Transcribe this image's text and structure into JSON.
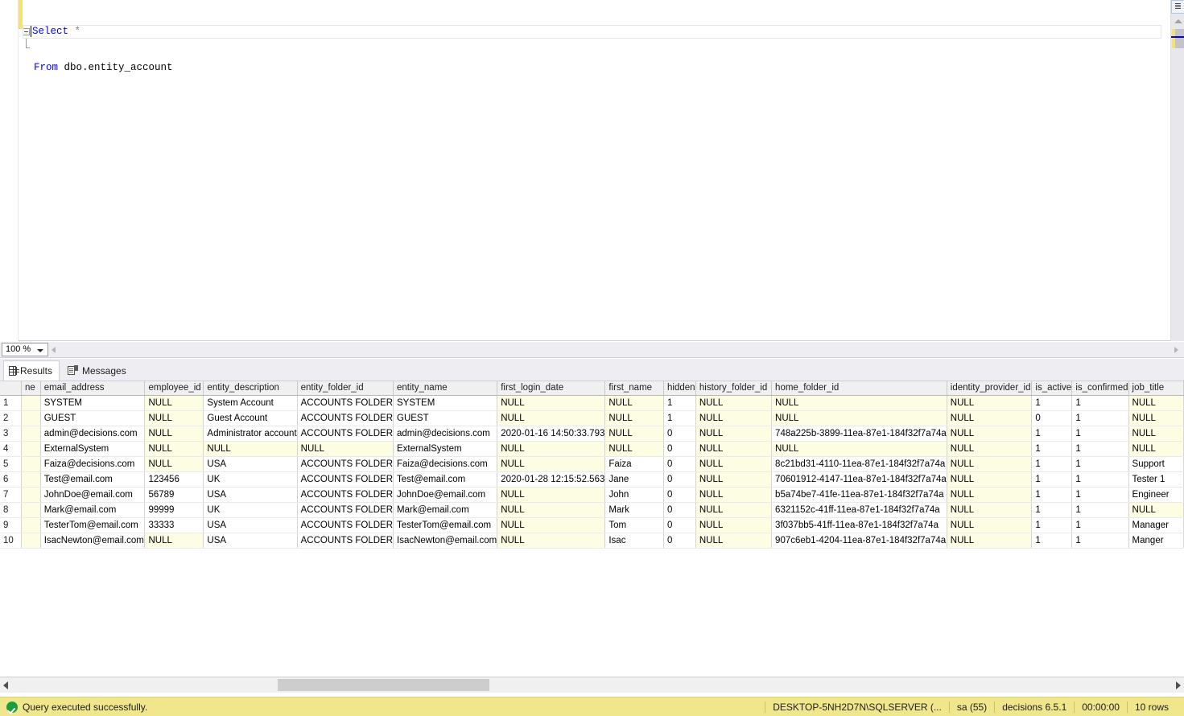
{
  "editor": {
    "lines": [
      {
        "keyword": "Select",
        "rest": " *",
        "outline": true
      },
      {
        "keyword": "From",
        "rest": " dbo.entity_account",
        "outline": false
      }
    ],
    "zoom_level": "100 %"
  },
  "tabs": [
    {
      "label": "Results",
      "icon": "grid-icon",
      "active": true
    },
    {
      "label": "Messages",
      "icon": "messages-icon",
      "active": false
    }
  ],
  "grid": {
    "columns": [
      "ne",
      "email_address",
      "employee_id",
      "entity_description",
      "entity_folder_id",
      "entity_name",
      "first_login_date",
      "first_name",
      "hidden",
      "history_folder_id",
      "home_folder_id",
      "identity_provider_id",
      "is_active",
      "is_confirmed",
      "job_title"
    ],
    "row_numbers": [
      "1",
      "2",
      "3",
      "4",
      "5",
      "6",
      "7",
      "8",
      "9",
      "10"
    ],
    "rows": [
      [
        "",
        "SYSTEM",
        "NULL",
        "System Account",
        "ACCOUNTS FOLDER",
        "SYSTEM",
        "NULL",
        "NULL",
        "1",
        "NULL",
        "NULL",
        "NULL",
        "1",
        "1",
        "NULL"
      ],
      [
        "",
        "GUEST",
        "NULL",
        "Guest Account",
        "ACCOUNTS FOLDER",
        "GUEST",
        "NULL",
        "NULL",
        "1",
        "NULL",
        "NULL",
        "NULL",
        "0",
        "1",
        "NULL"
      ],
      [
        "",
        "admin@decisions.com",
        "NULL",
        "Administrator account",
        "ACCOUNTS FOLDER",
        "admin@decisions.com",
        "2020-01-16 14:50:33.793",
        "NULL",
        "0",
        "NULL",
        "748a225b-3899-11ea-87e1-184f32f7a74a",
        "NULL",
        "1",
        "1",
        "NULL"
      ],
      [
        "",
        "ExternalSystem",
        "NULL",
        "NULL",
        "NULL",
        "ExternalSystem",
        "NULL",
        "NULL",
        "0",
        "NULL",
        "NULL",
        "NULL",
        "1",
        "1",
        "NULL"
      ],
      [
        "",
        "Faiza@decisions.com",
        "NULL",
        "USA",
        "ACCOUNTS FOLDER",
        "Faiza@decisions.com",
        "NULL",
        "Faiza",
        "0",
        "NULL",
        "8c21bd31-4110-11ea-87e1-184f32f7a74a",
        "NULL",
        "1",
        "1",
        "Support"
      ],
      [
        "",
        "Test@email.com",
        "123456",
        "UK",
        "ACCOUNTS FOLDER",
        "Test@email.com",
        "2020-01-28 12:15:52.563",
        "Jane",
        "0",
        "NULL",
        "70601912-4147-11ea-87e1-184f32f7a74a",
        "NULL",
        "1",
        "1",
        "Tester 1"
      ],
      [
        "",
        "JohnDoe@email.com",
        "56789",
        "USA",
        "ACCOUNTS FOLDER",
        "JohnDoe@email.com",
        "NULL",
        "John",
        "0",
        "NULL",
        "b5a74be7-41fe-11ea-87e1-184f32f7a74a",
        "NULL",
        "1",
        "1",
        "Engineer"
      ],
      [
        "",
        "Mark@email.com",
        "99999",
        "UK",
        "ACCOUNTS FOLDER",
        "Mark@email.com",
        "NULL",
        "Mark",
        "0",
        "NULL",
        "6321152c-41ff-11ea-87e1-184f32f7a74a",
        "NULL",
        "1",
        "1",
        "NULL"
      ],
      [
        "",
        "TesterTom@email.com",
        "33333",
        "USA",
        "ACCOUNTS FOLDER",
        "TesterTom@email.com",
        "NULL",
        "Tom",
        "0",
        "NULL",
        "3f037bb5-41ff-11ea-87e1-184f32f7a74a",
        "NULL",
        "1",
        "1",
        "Manager"
      ],
      [
        "",
        "IsacNewton@email.com",
        "NULL",
        "USA",
        "ACCOUNTS FOLDER",
        "IsacNewton@email.com",
        "NULL",
        "Isac",
        "0",
        "NULL",
        "907c6eb1-4204-11ea-87e1-184f32f7a74a",
        "NULL",
        "1",
        "1",
        "Manger"
      ]
    ]
  },
  "statusbar": {
    "message": "Query executed successfully.",
    "server": "DESKTOP-5NH2D7N\\SQLSERVER (...",
    "user": "sa (55)",
    "database": "decisions 6.5.1",
    "elapsed": "00:00:00",
    "rowcount": "10 rows"
  },
  "colors": {
    "keyword": "#0000ff",
    "null_cell_bg": "#fdfde4",
    "status_bg": "#f0e68c",
    "success_green": "#1f9b3f"
  }
}
